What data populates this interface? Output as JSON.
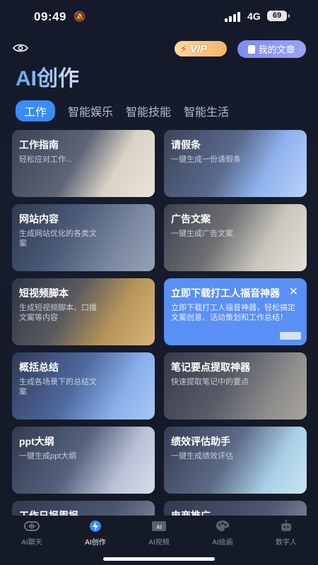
{
  "status": {
    "time": "09:49",
    "network": "4G",
    "battery": "69"
  },
  "header": {
    "vip_label": "VIP",
    "my_articles": "我的文章",
    "title": "AI创作"
  },
  "tabs": [
    {
      "label": "工作"
    },
    {
      "label": "智能娱乐"
    },
    {
      "label": "智能技能"
    },
    {
      "label": "智能生活"
    }
  ],
  "cards": [
    {
      "title": "工作指南",
      "desc": "轻松应对工作..."
    },
    {
      "title": "请假条",
      "desc": "一键生成一份请假条"
    },
    {
      "title": "网站内容",
      "desc": "生成网站优化的各类文案"
    },
    {
      "title": "广告文案",
      "desc": "一键生成广告文案"
    },
    {
      "title": "短视频脚本",
      "desc": "生成短视频脚本、口播文案等内容"
    },
    {
      "title": "立即下载打工人福音神器",
      "desc": "立即下载打工人福音神器，轻松搞定文案创意、活动策划和工作总结！"
    },
    {
      "title": "概括总结",
      "desc": "生成各场景下的总结文案"
    },
    {
      "title": "笔记要点提取神器",
      "desc": "快速提取笔记中的要点"
    },
    {
      "title": "ppt大纲",
      "desc": "一键生成ppt大纲"
    },
    {
      "title": "绩效评估助手",
      "desc": "一键生成绩效评估"
    },
    {
      "title": "工作日报周报",
      "desc": ""
    },
    {
      "title": "电商推广",
      "desc": ""
    }
  ],
  "bottom_nav": [
    {
      "label": "AI聊天"
    },
    {
      "label": "AI创作"
    },
    {
      "label": "AI视频"
    },
    {
      "label": "AI绘画"
    },
    {
      "label": "数字人"
    }
  ]
}
